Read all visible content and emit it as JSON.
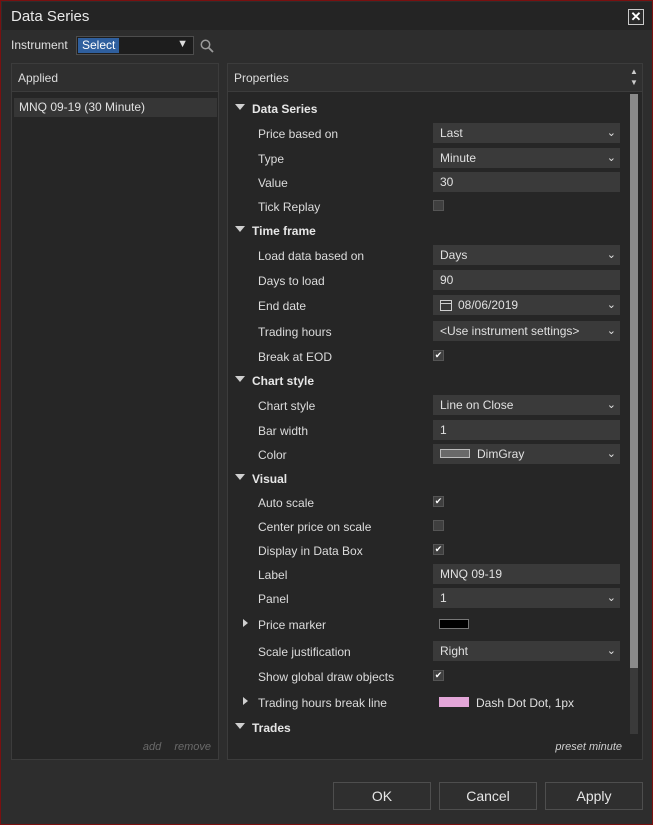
{
  "window": {
    "title": "Data Series",
    "close_glyph": "✕"
  },
  "instrument": {
    "label": "Instrument",
    "value": "Select"
  },
  "applied": {
    "header": "Applied",
    "items": [
      "MNQ 09-19 (30 Minute)"
    ],
    "add_label": "add",
    "remove_label": "remove"
  },
  "properties": {
    "header": "Properties",
    "preset_label": "preset minute",
    "data_series": {
      "title": "Data Series",
      "price_based_on": {
        "label": "Price based on",
        "value": "Last"
      },
      "type": {
        "label": "Type",
        "value": "Minute"
      },
      "value": {
        "label": "Value",
        "value": "30"
      },
      "tick_replay": {
        "label": "Tick Replay",
        "checked": false
      }
    },
    "time_frame": {
      "title": "Time frame",
      "load_data_based_on": {
        "label": "Load data based on",
        "value": "Days"
      },
      "days_to_load": {
        "label": "Days to load",
        "value": "90"
      },
      "end_date": {
        "label": "End date",
        "value": "08/06/2019"
      },
      "trading_hours": {
        "label": "Trading hours",
        "value": "<Use instrument settings>"
      },
      "break_at_eod": {
        "label": "Break at EOD",
        "checked": true
      }
    },
    "chart_style": {
      "title": "Chart style",
      "chart_style": {
        "label": "Chart style",
        "value": "Line on Close"
      },
      "bar_width": {
        "label": "Bar width",
        "value": "1"
      },
      "color": {
        "label": "Color",
        "value": "DimGray",
        "swatch": "#696969"
      }
    },
    "visual": {
      "title": "Visual",
      "auto_scale": {
        "label": "Auto scale",
        "checked": true
      },
      "center_price_on_scale": {
        "label": "Center price on scale",
        "checked": false
      },
      "display_in_data_box": {
        "label": "Display in Data Box",
        "checked": true
      },
      "label": {
        "label": "Label",
        "value": "MNQ 09-19"
      },
      "panel": {
        "label": "Panel",
        "value": "1"
      },
      "price_marker": {
        "label": "Price marker",
        "swatch": "#000000"
      },
      "scale_justification": {
        "label": "Scale justification",
        "value": "Right"
      },
      "show_global_draw_objects": {
        "label": "Show global draw objects",
        "checked": true
      },
      "trading_hours_break_line": {
        "label": "Trading hours break line",
        "value": "Dash Dot Dot, 1px",
        "swatch": "#e3a6d8"
      }
    },
    "trades": {
      "title": "Trades"
    }
  },
  "buttons": {
    "ok": "OK",
    "cancel": "Cancel",
    "apply": "Apply"
  },
  "icons": {
    "search": "search-icon",
    "dropdown": "chevron-down-icon",
    "calendar": "calendar-icon"
  },
  "colors": {
    "accent": "#2f5f9e",
    "window_border": "#7a1010"
  }
}
